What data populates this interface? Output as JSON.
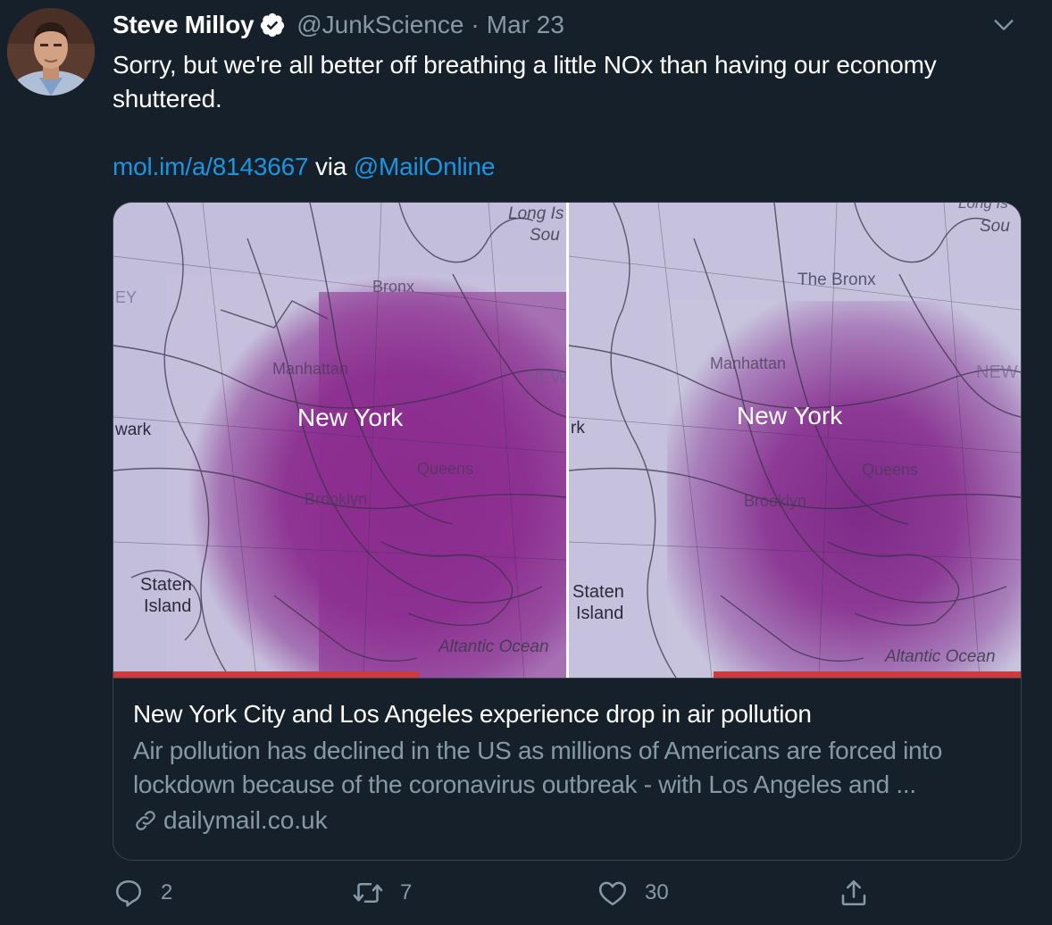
{
  "tweet": {
    "display_name": "Steve Milloy",
    "handle": "@JunkScience",
    "separator": "·",
    "date": "Mar 23",
    "text_line1": "Sorry, but we're all better off breathing a little NOx than having our economy shuttered.",
    "link_url_text": "mol.im/a/8143667",
    "via_text": " via ",
    "mention": "@MailOnline"
  },
  "card": {
    "image": {
      "left_panel": {
        "city": "New York",
        "labels": [
          "Long Is",
          "Sou",
          "Bronx",
          "Manhattan",
          "NEW",
          "wark",
          "EY",
          "Queens",
          "Brooklyn",
          "Staten",
          "Island",
          "Altantic Ocean"
        ]
      },
      "right_panel": {
        "city": "New York",
        "labels": [
          "Long Is",
          "Sou",
          "The Bronx",
          "Manhattan",
          "NEW",
          "rk",
          "Queens",
          "Brooklyn",
          "Staten",
          "Island",
          "Altantic Ocean"
        ]
      }
    },
    "title": "New York City and Los Angeles experience drop in air pollution",
    "description": "Air pollution has declined in the US as millions of Americans are forced into lockdown because of the coronavirus outbreak - with Los Angeles and ...",
    "domain": "dailymail.co.uk"
  },
  "actions": {
    "reply_count": "2",
    "retweet_count": "7",
    "like_count": "30"
  },
  "icons": [
    "verified-badge-icon",
    "chevron-down-icon",
    "link-icon",
    "reply-icon",
    "retweet-icon",
    "like-icon",
    "share-icon"
  ],
  "colors": {
    "background": "#15202b",
    "link": "#1b95e0",
    "secondary_text": "#8899a6",
    "border": "#38444d",
    "map_purple": "#8b2a8e"
  }
}
